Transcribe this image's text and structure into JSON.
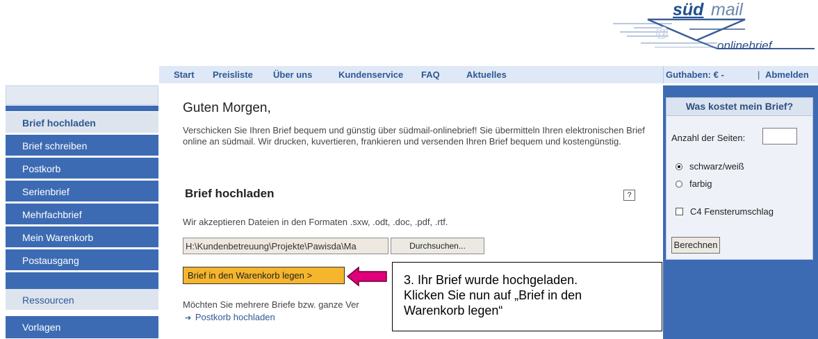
{
  "logo": {
    "brand_bold": "süd",
    "brand_light": "mail",
    "tagline": "onlinebrief",
    "at_symbol": "@",
    "icon": "envelope-at-icon"
  },
  "topnav": {
    "items": [
      "Start",
      "Preisliste",
      "Über uns",
      "Kundenservice",
      "FAQ",
      "Aktuelles"
    ],
    "balance": "Guthaben: € -",
    "separator": "|",
    "logout": "Abmelden"
  },
  "sidebar": {
    "items": [
      "Brief hochladen",
      "Brief schreiben",
      "Postkorb",
      "Serienbrief",
      "Mehrfachbrief",
      "Mein Warenkorb",
      "Postausgang"
    ],
    "section_label": "Ressourcen",
    "section_items": [
      "Vorlagen"
    ]
  },
  "main": {
    "greeting": "Guten Morgen,",
    "intro": "Verschicken Sie Ihren Brief bequem und günstig über südmail-onlinebrief! Sie übermitteln Ihren elektronischen Brief online an südmail. Wir drucken, kuvertieren, frankieren und versenden Ihren Brief bequem und kostengünstig.",
    "upload_title": "Brief hochladen",
    "help_label": "?",
    "formats": "Wir akzeptieren Dateien in den Formaten .sxw, .odt, .doc, .pdf, .rtf.",
    "file_path": "H:\\Kundenbetreuung\\Projekte\\Pawisda\\Ma",
    "browse_label": "Durchsuchen...",
    "cart_button": "Brief in den Warenkorb legen >",
    "multi_text": "Möchten Sie mehrere Briefe bzw. ganze Ver",
    "postkorb_arrow": "➔",
    "postkorb_link": "Postkorb hochladen"
  },
  "callout": {
    "line1": "3. Ihr Brief wurde hochgeladen.",
    "line2": "Klicken Sie nun auf „Brief in den",
    "line3": "Warenkorb legen“",
    "arrow_color": "#e0007a"
  },
  "price_panel": {
    "title": "Was kostet mein Brief?",
    "pages_label": "Anzahl der Seiten:",
    "pages_value": "",
    "color_options": [
      "schwarz/weiß",
      "farbig"
    ],
    "selected_color": "schwarz/weiß",
    "envelope_option": "C4 Fensterumschlag",
    "envelope_checked": false,
    "calc_button": "Berechnen"
  },
  "colors": {
    "nav_blue": "#3d6bb3",
    "nav_light": "#dfe8f6",
    "link_blue": "#2e5894",
    "cart_orange": "#f5b52c"
  }
}
